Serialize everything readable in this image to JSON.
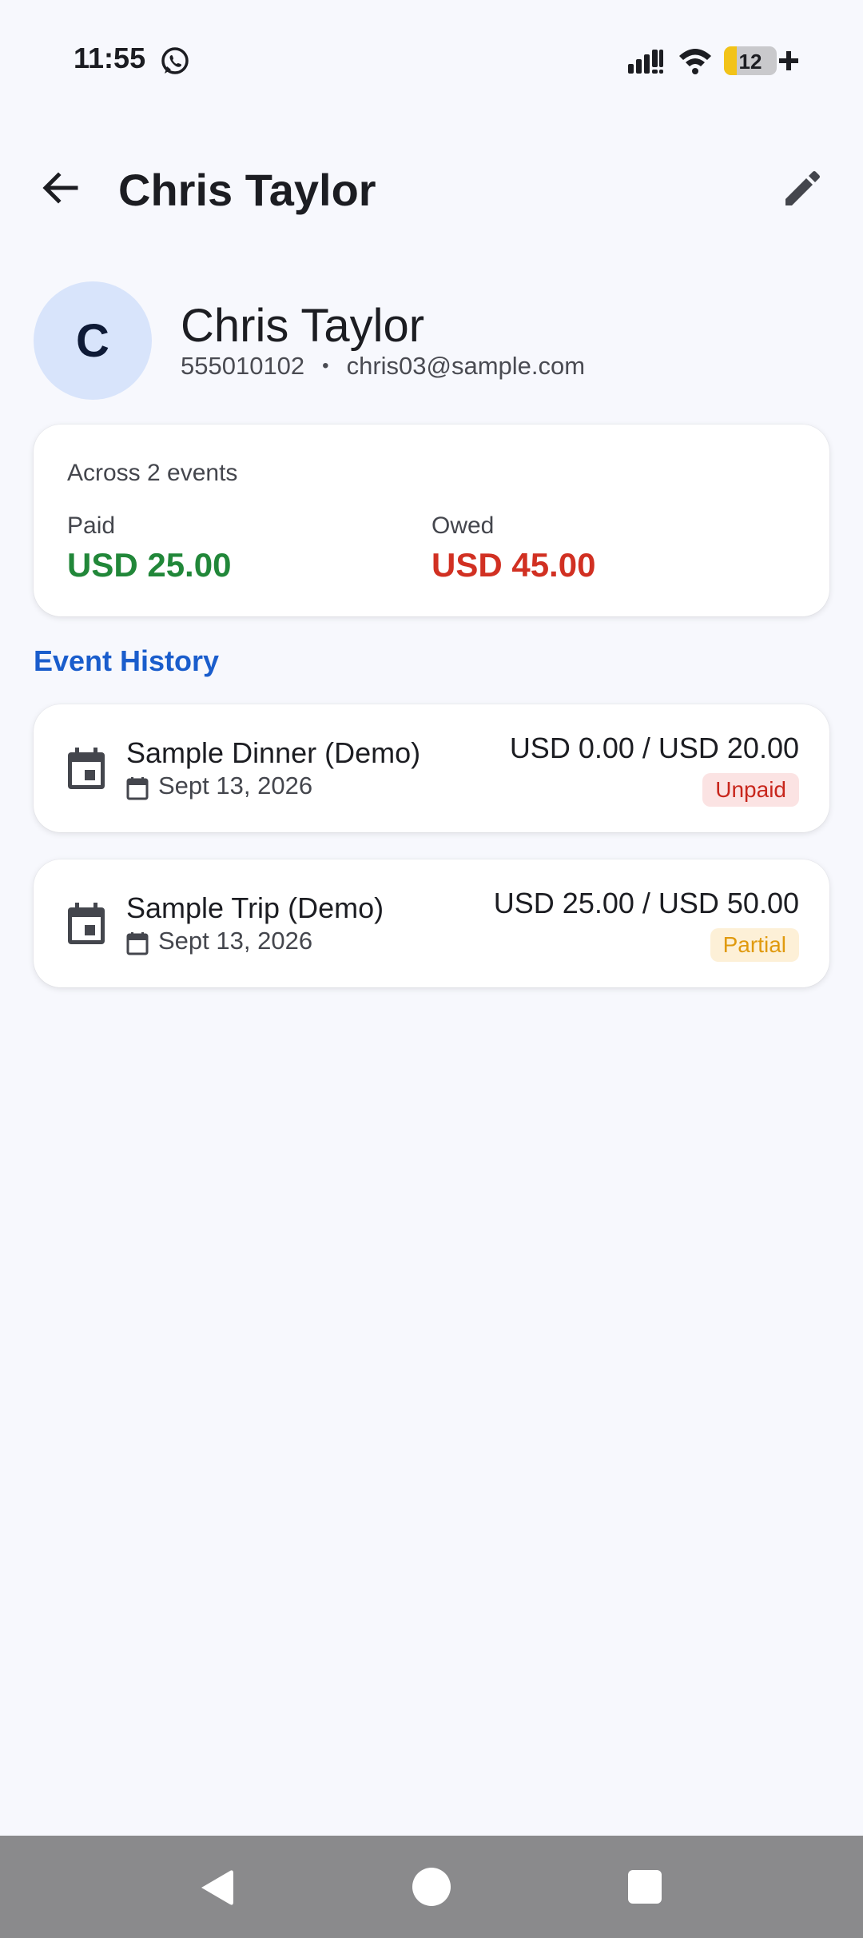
{
  "status_bar": {
    "time": "11:55",
    "battery": "12",
    "icons": [
      "whatsapp-icon",
      "signal-icon",
      "wifi-icon",
      "battery-icon",
      "charging-plus-icon"
    ]
  },
  "app_bar": {
    "title": "Chris Taylor",
    "back_icon": "arrow-back-icon",
    "edit_icon": "pencil-edit-icon"
  },
  "profile": {
    "initial": "C",
    "name": "Chris Taylor",
    "phone": "555010102",
    "separator": "•",
    "email": "chris03@sample.com"
  },
  "summary": {
    "label": "Across 2 events",
    "paid_label": "Paid",
    "paid_value": "USD 25.00",
    "owed_label": "Owed",
    "owed_value": "USD 45.00"
  },
  "section_title": "Event History",
  "events": [
    {
      "name": "Sample Dinner (Demo)",
      "date": "Sept 13, 2026",
      "amount": "USD 0.00 / USD 20.00",
      "status": "Unpaid"
    },
    {
      "name": "Sample Trip (Demo)",
      "date": "Sept 13, 2026",
      "amount": "USD 25.00 / USD 50.00",
      "status": "Partial"
    }
  ],
  "colors": {
    "background": "#f7f8fd",
    "paid": "#218739",
    "owed": "#d13022",
    "accent": "#1a5dcc",
    "avatar_bg": "#d8e4fb",
    "unpaid_badge_bg": "#fbe3e3",
    "partial_badge_bg": "#fdf0d7"
  }
}
